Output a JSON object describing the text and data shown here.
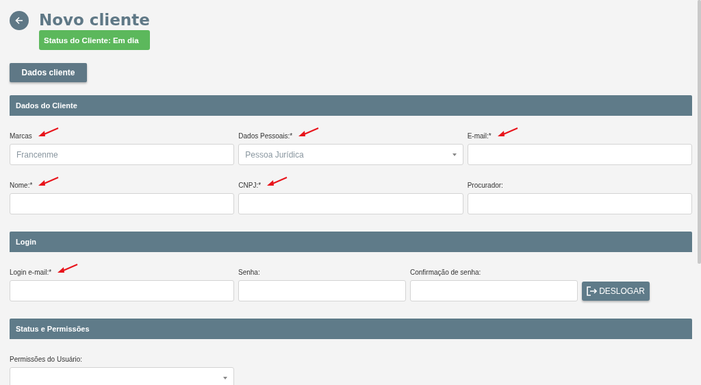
{
  "header": {
    "title": "Novo cliente",
    "status_badge": "Status do Cliente: Em dia"
  },
  "tabs": [
    {
      "label": "Dados cliente",
      "selected": true
    }
  ],
  "sections": [
    {
      "title": "Dados do Cliente",
      "rows": [
        [
          {
            "label": "Marcas",
            "kind": "text",
            "placeholder": "Francenme",
            "arrow": true
          },
          {
            "label": "Dados Pessoais:*",
            "kind": "select",
            "value": "Pessoa Jurídica",
            "arrow": true
          },
          {
            "label": "E-mail:*",
            "kind": "text",
            "arrow": true
          }
        ],
        [
          {
            "label": "Nome:*",
            "kind": "text",
            "arrow": true
          },
          {
            "label": "CNPJ:*",
            "kind": "text",
            "arrow": true
          },
          {
            "label": "Procurador:",
            "kind": "text",
            "arrow": false
          }
        ]
      ]
    },
    {
      "title": "Login",
      "rows": [
        [
          {
            "label": "Login e-mail:*",
            "kind": "text",
            "arrow": true
          },
          {
            "label": "Senha:",
            "kind": "text",
            "arrow": false
          },
          {
            "label": "Confirmação de senha:",
            "kind": "text",
            "arrow": false
          },
          {
            "label": "DESLOGAR",
            "kind": "button"
          }
        ]
      ]
    },
    {
      "title": "Status e Permissões",
      "rows": [
        [
          {
            "label": "Permissões do Usuário:",
            "kind": "select",
            "arrow": false
          }
        ]
      ]
    }
  ]
}
